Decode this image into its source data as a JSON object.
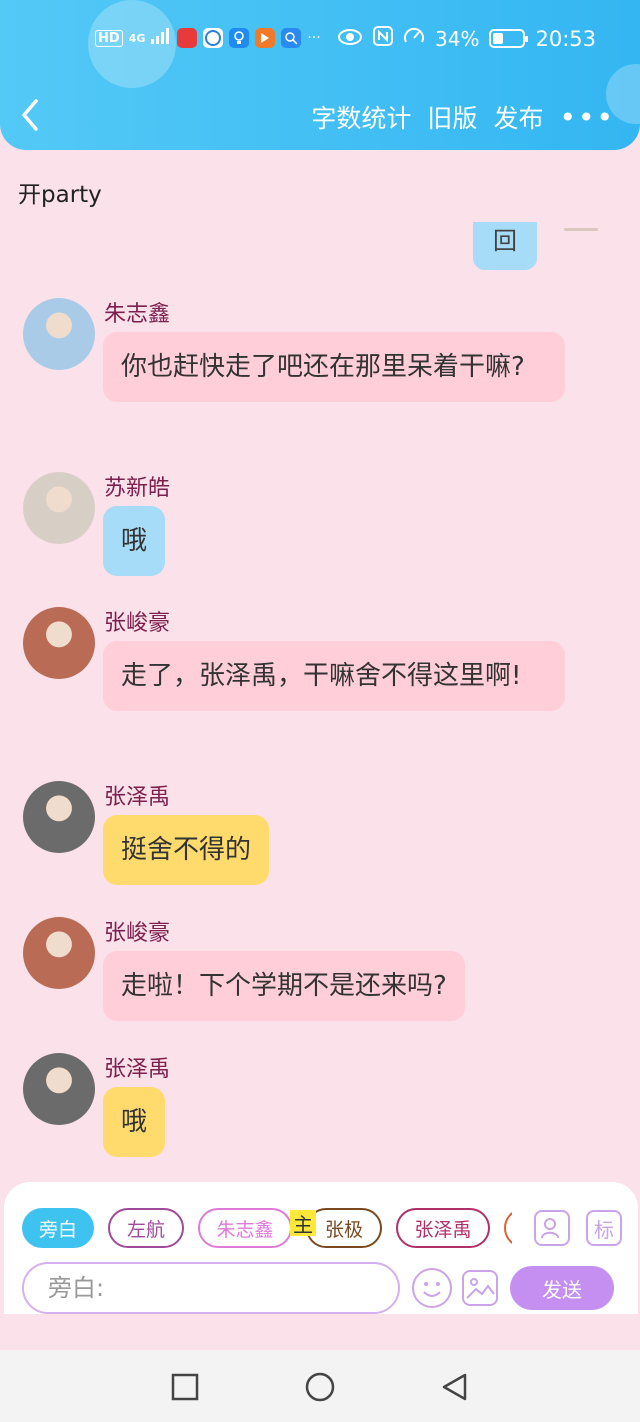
{
  "status_bar": {
    "left_labels": [
      "HD",
      "4G"
    ],
    "battery_percent": "34%",
    "battery_level": 0.34,
    "time": "20:53"
  },
  "toolbar": {
    "back_icon": "back-chevron-icon",
    "word_count": "字数统计",
    "old_version": "旧版",
    "publish": "发布",
    "more": "•••"
  },
  "chat_title": "开party",
  "partial_message": "回",
  "messages": [
    {
      "name": "朱志鑫",
      "text": "你也赶快走了吧还在那里呆着干嘛?",
      "color": "#ffced9",
      "avatar_bg": "#a9cbe8"
    },
    {
      "name": "苏新皓",
      "text": "哦",
      "color": "#a6dcf7",
      "avatar_bg": "#d7cfc6"
    },
    {
      "name": "张峻豪",
      "text": "走了，张泽禹，干嘛舍不得这里啊!",
      "color": "#ffced9",
      "avatar_bg": "#b96b56"
    },
    {
      "name": "张泽禹",
      "text": "挺舍不得的",
      "color": "#ffdb6e",
      "avatar_bg": "#6b6b6b"
    },
    {
      "name": "张峻豪",
      "text": "走啦！下个学期不是还来吗?",
      "color": "#ffced9",
      "avatar_bg": "#b96b56"
    },
    {
      "name": "张泽禹",
      "text": "哦",
      "color": "#ffdb6e",
      "avatar_bg": "#6b6b6b"
    }
  ],
  "input_panel": {
    "chips": [
      {
        "label": "旁白",
        "color": "#3ec3f0"
      },
      {
        "label": "左航",
        "color": "#a04a9a"
      },
      {
        "label": "朱志鑫",
        "color": "#e07ad8"
      },
      {
        "label": "张极",
        "color": "#7a4a1f"
      },
      {
        "label": "张泽禹",
        "color": "#b0306a"
      },
      {
        "label": "",
        "color": "#e06030"
      }
    ],
    "highlight_char": "主",
    "role_icon": "person-icon",
    "mark_label": "标",
    "placeholder": "旁白:",
    "send": "发送"
  },
  "navbar": {
    "icons": [
      "recent-apps-icon",
      "home-icon",
      "back-triangle-icon"
    ]
  }
}
